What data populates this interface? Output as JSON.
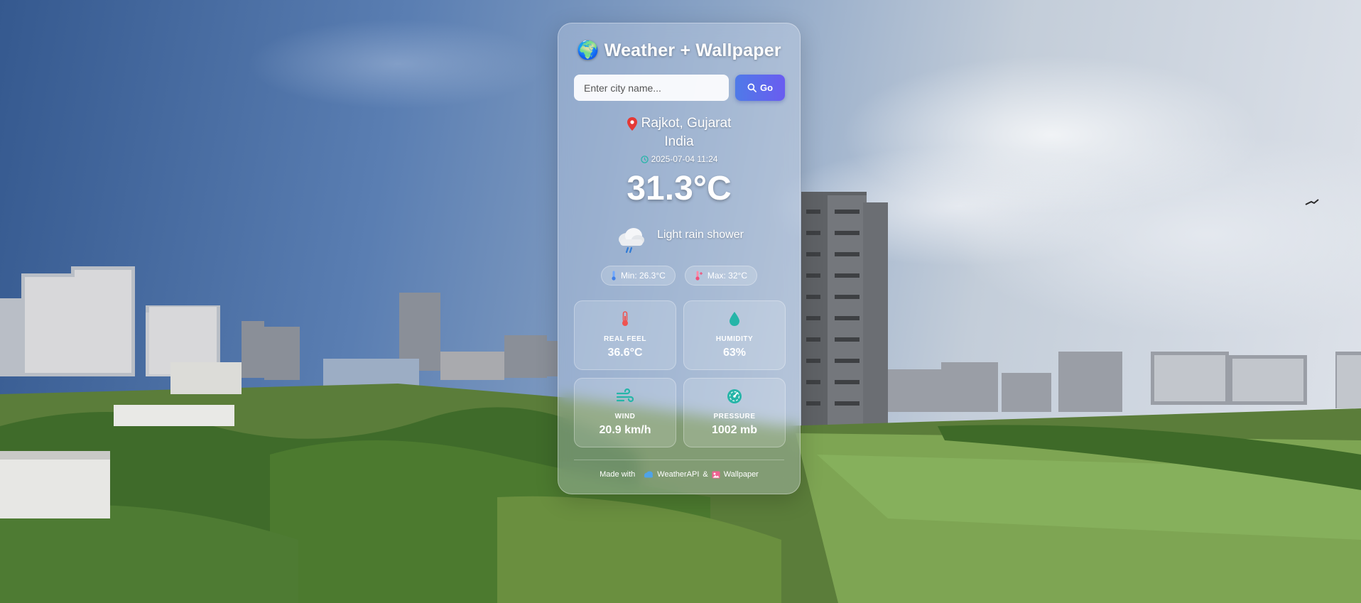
{
  "app": {
    "title": "Weather + Wallpaper",
    "title_icon": "globe-icon"
  },
  "search": {
    "placeholder": "Enter city name...",
    "value": "",
    "button_label": "Go",
    "button_icon": "magnifier-icon"
  },
  "location": {
    "city_region": "Rajkot, Gujarat",
    "country": "India",
    "pin_icon": "map-pin-icon"
  },
  "datetime": {
    "value": "2025-07-04 11:24",
    "icon": "clock-icon"
  },
  "current": {
    "temperature": "31.3°C",
    "condition": "Light rain shower",
    "condition_icon": "cloud-rain-icon"
  },
  "range": {
    "min_label": "Min: 26.3°C",
    "max_label": "Max: 32°C"
  },
  "stats": [
    {
      "label": "REAL FEEL",
      "value": "36.6°C",
      "icon": "thermometer-icon",
      "color": "#ef5350"
    },
    {
      "label": "HUMIDITY",
      "value": "63%",
      "icon": "droplet-icon",
      "color": "#26b5a8"
    },
    {
      "label": "WIND",
      "value": "20.9 km/h",
      "icon": "wind-icon",
      "color": "#26b5a8"
    },
    {
      "label": "PRESSURE",
      "value": "1002 mb",
      "icon": "gauge-icon",
      "color": "#26b5a8"
    }
  ],
  "footer": {
    "prefix": "Made with",
    "api": "WeatherAPI",
    "joiner": "&",
    "wallpaper": "Wallpaper"
  },
  "colors": {
    "accent_blue": "#4f7ae8",
    "accent_purple": "#6a5cf0",
    "pin_red": "#e53935",
    "teal": "#26b5a8"
  }
}
